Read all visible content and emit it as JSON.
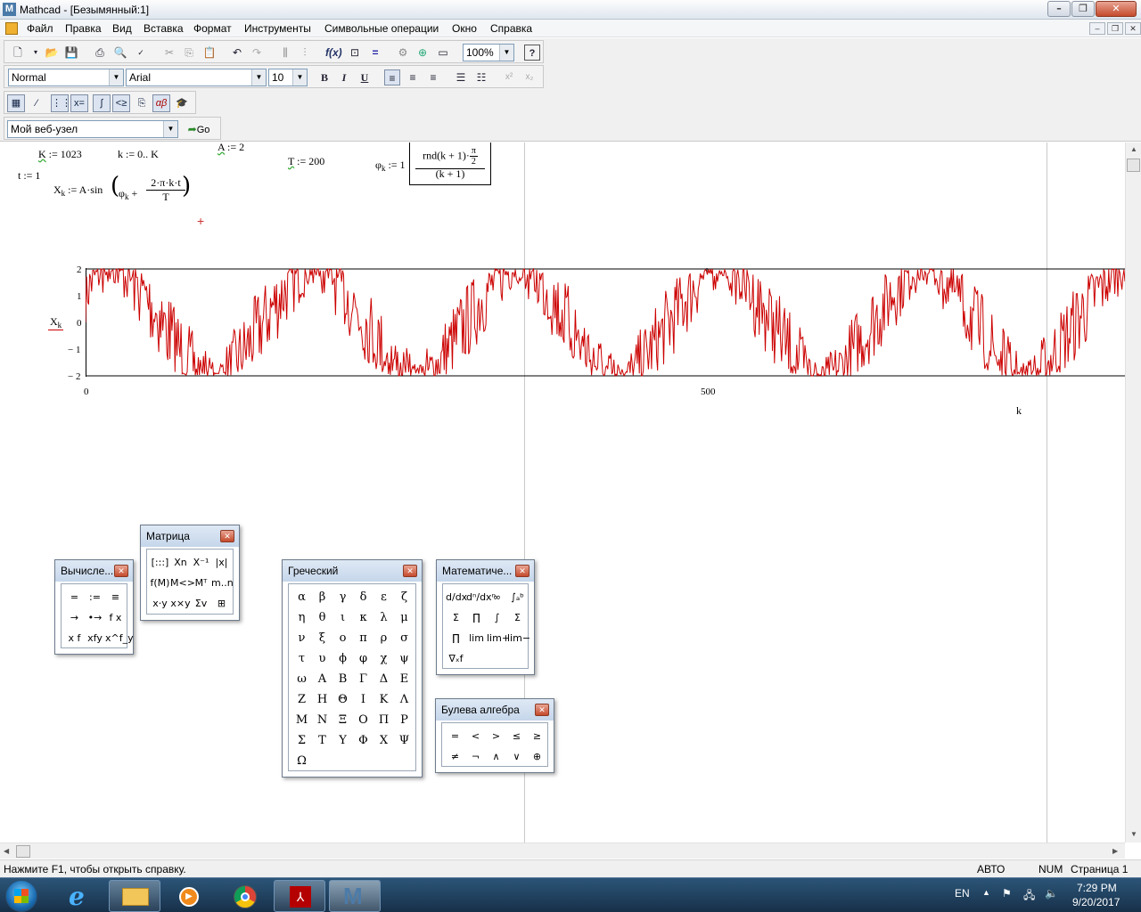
{
  "window": {
    "title": "Mathcad - [Безымянный:1]",
    "app_letter": "M"
  },
  "menu": [
    "Файл",
    "Правка",
    "Вид",
    "Вставка",
    "Формат",
    "Инструменты",
    "Символьные операции",
    "Окно",
    "Справка"
  ],
  "toolbar": {
    "zoom": "100%",
    "style": "Normal",
    "font": "Arial",
    "size": "10",
    "bold": "B",
    "italic": "I",
    "underline": "U",
    "web_url": "Мой веб-узел",
    "go": "Go"
  },
  "worksheet": {
    "defs": {
      "K_name": "K",
      "K_rest": " := 1023",
      "k_range": "k := 0.. K",
      "A_name": "A",
      "A_rest": " := 2",
      "T_name": "T",
      "T_rest": " := 200",
      "t_def": "t := 1",
      "phi_lhs": "φ",
      "phi_lhs_sub": "k",
      "phi_mid": " := 1",
      "phi_num": "rnd(k + 1)·",
      "phi_pi": "π",
      "phi_two": "2",
      "phi_den": "(k + 1)",
      "X_lhs": "X",
      "X_lhs_sub": "k",
      "X_rhs": " := A·sin",
      "X_phi": "φ",
      "X_phi_sub": "k",
      "X_plus": " + ",
      "X_num": "2·π·k·t",
      "X_den": "T"
    },
    "cursor": "+",
    "plot": {
      "y_label": "X",
      "y_label_sub": "k",
      "x_label": "k",
      "yticks": [
        "2",
        "1",
        "0",
        "− 1",
        "− 2"
      ],
      "xticks": [
        "0",
        "500"
      ],
      "ymin": -2,
      "ymax": 2,
      "xmin": 0,
      "xmax": 1023
    }
  },
  "colors": {
    "trace": "#cc0000"
  },
  "palettes": {
    "calc": {
      "title": "Вычисле...",
      "items": [
        "=",
        ":=",
        "≡",
        "→",
        "•→",
        "f x",
        "x f",
        "xfy",
        "x^f_y"
      ]
    },
    "matrix": {
      "title": "Матрица",
      "items": [
        "[:::]",
        "Xn",
        "X⁻¹",
        "|x|",
        "f(M)",
        "M<>",
        "Mᵀ",
        "m..n",
        "x·y",
        "x×y",
        "Σv",
        "⊞"
      ]
    },
    "greek": {
      "title": "Греческий",
      "items": [
        "α",
        "β",
        "γ",
        "δ",
        "ε",
        "ζ",
        "η",
        "θ",
        "ι",
        "κ",
        "λ",
        "μ",
        "ν",
        "ξ",
        "ο",
        "π",
        "ρ",
        "σ",
        "τ",
        "υ",
        "ϕ",
        "φ",
        "χ",
        "ψ",
        "ω",
        "Α",
        "Β",
        "Γ",
        "Δ",
        "Ε",
        "Ζ",
        "Η",
        "Θ",
        "Ι",
        "Κ",
        "Λ",
        "Μ",
        "Ν",
        "Ξ",
        "Ο",
        "Π",
        "Ρ",
        "Σ",
        "Τ",
        "Υ",
        "Φ",
        "Χ",
        "Ψ",
        "Ω"
      ]
    },
    "calculus": {
      "title": "Математиче...",
      "items": [
        "d/dx",
        "dⁿ/dxⁿ",
        "∞",
        "∫ₐᵇ",
        "Σ",
        "∏",
        "∫",
        "Σ",
        "∏",
        "lim",
        "lim+",
        "lim−",
        "∇ₓf"
      ]
    },
    "boolean": {
      "title": "Булева алгебра",
      "items": [
        "=",
        "<",
        ">",
        "≤",
        "≥",
        "≠",
        "¬",
        "∧",
        "∨",
        "⊕"
      ]
    }
  },
  "statusbar": {
    "help": "Нажмите F1, чтобы открыть справку.",
    "mode": "АВТО",
    "num": "NUM",
    "page": "Страница 1"
  },
  "taskbar": {
    "lang": "EN",
    "time": "7:29 PM",
    "date": "9/20/2017"
  }
}
